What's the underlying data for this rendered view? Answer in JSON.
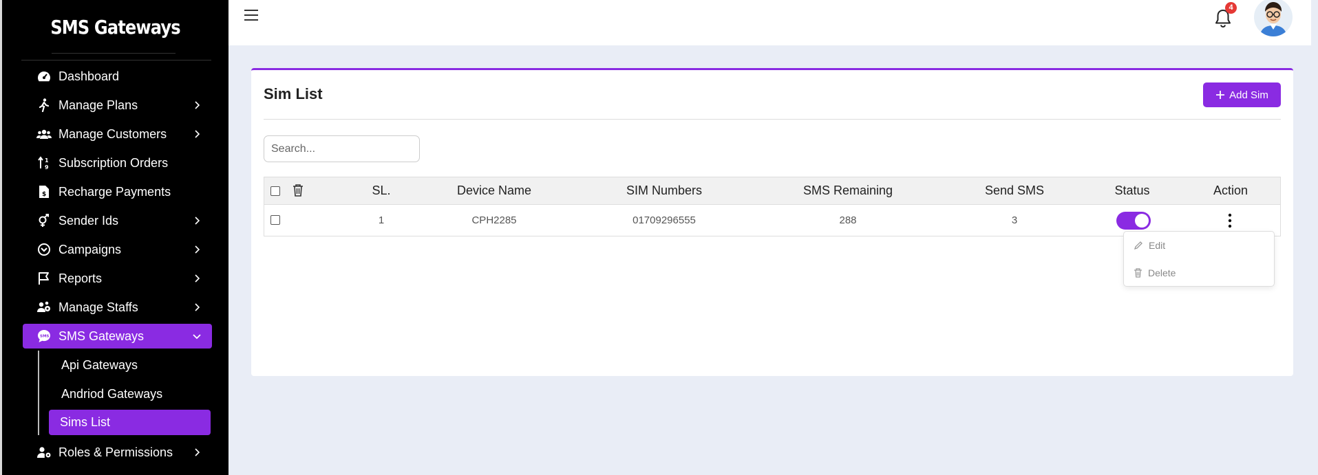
{
  "sidebar": {
    "brand": "SMS Gateways",
    "items": [
      {
        "label": "Dashboard",
        "icon": "dashboard-icon",
        "has_chevron": false
      },
      {
        "label": "Manage Plans",
        "icon": "walking-icon",
        "has_chevron": true
      },
      {
        "label": "Manage Customers",
        "icon": "users-icon",
        "has_chevron": true
      },
      {
        "label": "Subscription Orders",
        "icon": "sort-icon",
        "has_chevron": false
      },
      {
        "label": "Recharge Payments",
        "icon": "invoice-icon",
        "has_chevron": false
      },
      {
        "label": "Sender Ids",
        "icon": "gender-icon",
        "has_chevron": true
      },
      {
        "label": "Campaigns",
        "icon": "campaign-icon",
        "has_chevron": true
      },
      {
        "label": "Reports",
        "icon": "flag-icon",
        "has_chevron": true
      },
      {
        "label": "Manage Staffs",
        "icon": "staff-icon",
        "has_chevron": true
      },
      {
        "label": "SMS Gateways",
        "icon": "sms-icon",
        "has_chevron": true,
        "expanded": true
      }
    ],
    "sub_items": [
      {
        "label": "Api Gateways"
      },
      {
        "label": "Andriod Gateways"
      },
      {
        "label": "Sims List",
        "active": true
      }
    ],
    "bottom_item": {
      "label": "Roles & Permissions",
      "icon": "user-gear-icon"
    }
  },
  "topbar": {
    "notification_count": "4"
  },
  "card": {
    "title": "Sim List",
    "add_button": "Add Sim",
    "search_placeholder": "Search...",
    "columns": [
      "SL.",
      "Device Name",
      "SIM Numbers",
      "SMS Remaining",
      "Send SMS",
      "Status",
      "Action"
    ],
    "rows": [
      {
        "sl": "1",
        "device_name": "CPH2285",
        "sim_numbers": "01709296555",
        "sms_remaining": "288",
        "send_sms": "3",
        "status": true
      }
    ],
    "row_menu": [
      "Edit",
      "Delete"
    ]
  },
  "colors": {
    "accent": "#8a2be2",
    "sidebar_bg": "#000000",
    "page_bg": "#e9edf6",
    "badge": "#e53935"
  }
}
